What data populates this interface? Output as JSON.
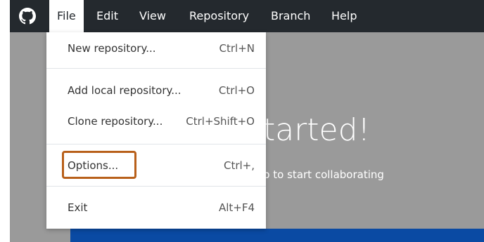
{
  "menubar": {
    "logo_icon": "github-octocat-icon",
    "items": [
      {
        "label": "File"
      },
      {
        "label": "Edit"
      },
      {
        "label": "View"
      },
      {
        "label": "Repository"
      },
      {
        "label": "Branch"
      },
      {
        "label": "Help"
      }
    ],
    "active_item": "File"
  },
  "welcome": {
    "title_partial": "tarted!",
    "subtitle_partial": "p to start collaborating"
  },
  "file_menu": {
    "items": [
      {
        "label": "New repository...",
        "shortcut": "Ctrl+N"
      },
      {
        "label": "Add local repository...",
        "shortcut": "Ctrl+O"
      },
      {
        "label": "Clone repository...",
        "shortcut": "Ctrl+Shift+O"
      },
      {
        "label": "Options...",
        "shortcut": "Ctrl+,",
        "highlighted": true
      },
      {
        "label": "Exit",
        "shortcut": "Alt+F4"
      }
    ]
  },
  "colors": {
    "menubar_bg": "#24292e",
    "app_bg": "#9a9a9a",
    "highlight_border": "#b8601a",
    "blue_strip": "#0a4aa3"
  }
}
